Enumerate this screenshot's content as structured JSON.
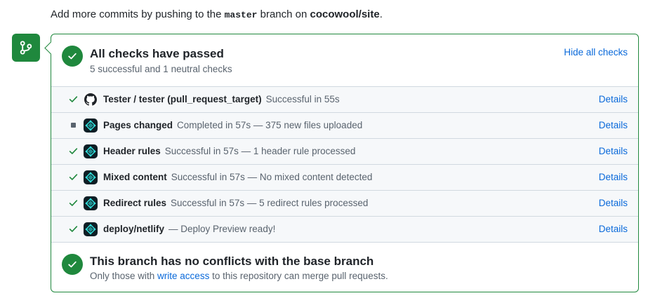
{
  "intro": {
    "prefix": "Add more commits by pushing to the ",
    "branch": "master",
    "middle": " branch on ",
    "repo": "cocowool/site",
    "suffix": "."
  },
  "summary": {
    "title": "All checks have passed",
    "subtitle": "5 successful and 1 neutral checks",
    "hide_link": "Hide all checks"
  },
  "checks": [
    {
      "name": "Tester / tester (pull_request_target)",
      "description": "Successful in 55s",
      "details": "Details",
      "status": "success",
      "icon": "github-icon"
    },
    {
      "name": "Pages changed",
      "description": "Completed in 57s — 375 new files uploaded",
      "details": "Details",
      "status": "neutral",
      "icon": "netlify-icon"
    },
    {
      "name": "Header rules",
      "description": "Successful in 57s — 1 header rule processed",
      "details": "Details",
      "status": "success",
      "icon": "netlify-icon"
    },
    {
      "name": "Mixed content",
      "description": "Successful in 57s — No mixed content detected",
      "details": "Details",
      "status": "success",
      "icon": "netlify-icon"
    },
    {
      "name": "Redirect rules",
      "description": "Successful in 57s — 5 redirect rules processed",
      "details": "Details",
      "status": "success",
      "icon": "netlify-icon"
    },
    {
      "name": "deploy/netlify",
      "description": "— Deploy Preview ready!",
      "details": "Details",
      "status": "success",
      "icon": "netlify-icon"
    }
  ],
  "merge": {
    "title": "This branch has no conflicts with the base branch",
    "sub_prefix": "Only those with ",
    "sub_link": "write access",
    "sub_suffix": " to this repository can merge pull requests."
  },
  "colors": {
    "success": "#1f883d",
    "link": "#0969da",
    "muted": "#59636e",
    "row_bg": "#f6f8fa",
    "netlify_teal": "#32e6e2"
  }
}
